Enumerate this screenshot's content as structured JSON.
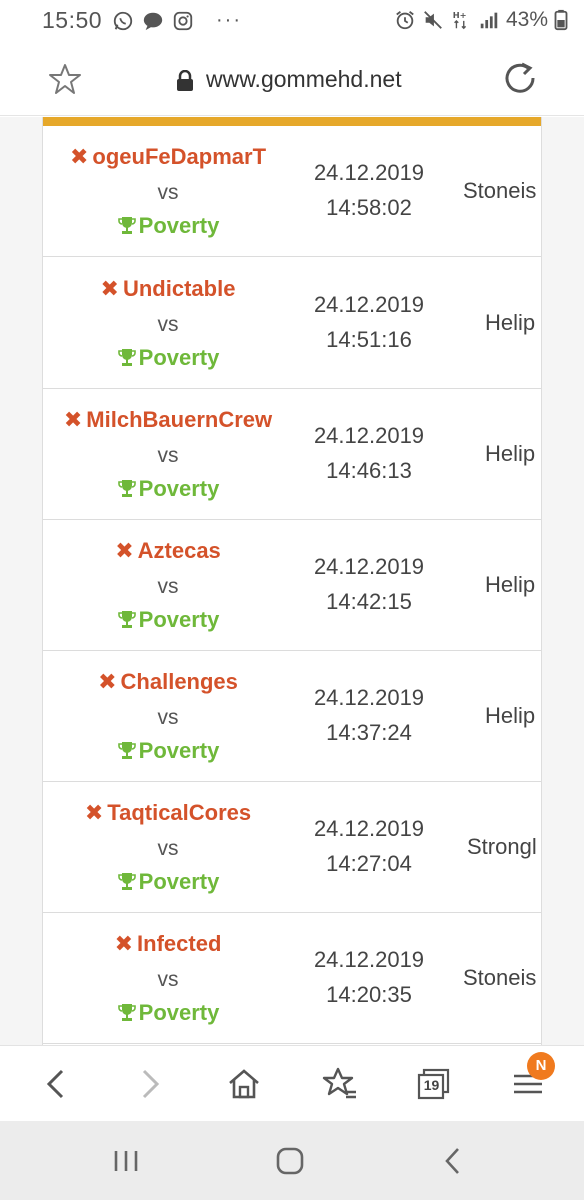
{
  "status_bar": {
    "time": "15:50",
    "dots": "···",
    "battery": "43%",
    "icons": [
      "whatsapp-icon",
      "chat-bubble-icon",
      "instagram-icon",
      "alarm-icon",
      "mute-icon",
      "signal-icon",
      "battery-icon"
    ]
  },
  "browser": {
    "url": "www.gommehd.net",
    "tabs_count": "19",
    "notification_badge": "N"
  },
  "matches": [
    {
      "loser": "ogeuFeDapmarT",
      "vs": "vs",
      "winner": "Poverty",
      "date": "24.12.2019",
      "time": "14:58:02",
      "map": "Stoneis"
    },
    {
      "loser": "Undictable",
      "vs": "vs",
      "winner": "Poverty",
      "date": "24.12.2019",
      "time": "14:51:16",
      "map": "Helip"
    },
    {
      "loser": "MilchBauernCrew",
      "vs": "vs",
      "winner": "Poverty",
      "date": "24.12.2019",
      "time": "14:46:13",
      "map": "Helip"
    },
    {
      "loser": "Aztecas",
      "vs": "vs",
      "winner": "Poverty",
      "date": "24.12.2019",
      "time": "14:42:15",
      "map": "Helip"
    },
    {
      "loser": "Challenges",
      "vs": "vs",
      "winner": "Poverty",
      "date": "24.12.2019",
      "time": "14:37:24",
      "map": "Helip"
    },
    {
      "loser": "TaqticalCores",
      "vs": "vs",
      "winner": "Poverty",
      "date": "24.12.2019",
      "time": "14:27:04",
      "map": "Strongl"
    },
    {
      "loser": "Infected",
      "vs": "vs",
      "winner": "Poverty",
      "date": "24.12.2019",
      "time": "14:20:35",
      "map": "Stoneis"
    }
  ],
  "colors": {
    "loser": "#d4522a",
    "winner": "#6fb83a",
    "accent_bar": "#e6a82a",
    "badge": "#f07a1e"
  }
}
